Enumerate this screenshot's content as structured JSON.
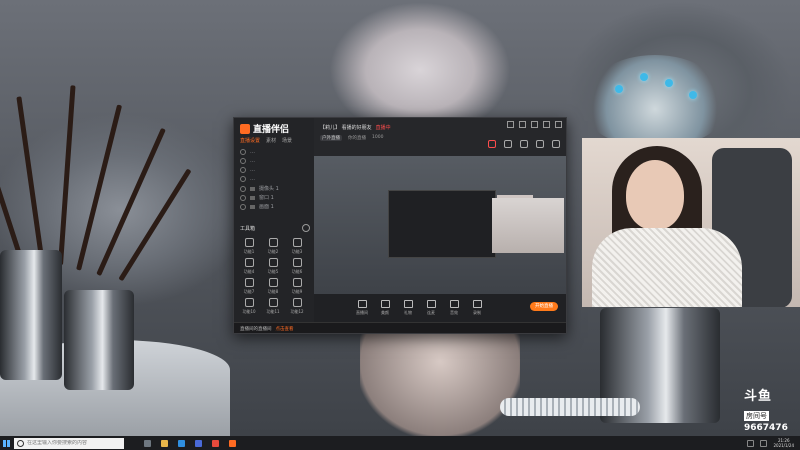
{
  "app": {
    "name": "直播伴侣",
    "left_tabs": [
      "直播设置",
      "素材",
      "场景"
    ],
    "source_rows": [
      "…",
      "…",
      "…",
      "…",
      "摄像头 1",
      "窗口 1",
      "画面 1"
    ],
    "tools_title": "工具箱",
    "tools": [
      "功能1",
      "功能2",
      "功能3",
      "功能4",
      "功能5",
      "功能6",
      "功能7",
      "功能8",
      "功能9",
      "功能10",
      "功能11",
      "功能12"
    ],
    "notice_text": "直播间的直播间",
    "notice_link": "点击查看"
  },
  "room": {
    "title": "【莉儿】 看播的好朋友",
    "live_badge": "直播中",
    "meta": [
      "户外直播",
      "你的直播",
      "1000"
    ]
  },
  "toolbar": {
    "buttons": [
      "直播间",
      "美颜",
      "礼物",
      "连麦",
      "音效",
      "录制"
    ],
    "start_label": "开始直播"
  },
  "watermark": {
    "logo": "斗鱼",
    "room_label": "房间号",
    "room_number": "9667476"
  },
  "taskbar": {
    "search_placeholder": "在这里输入你要搜索的内容",
    "time": "21:26",
    "date": "2021/1/24"
  },
  "colors": {
    "accent": "#ff6b22",
    "live": "#ff4d4d",
    "taskbar": "#1c1d20"
  }
}
